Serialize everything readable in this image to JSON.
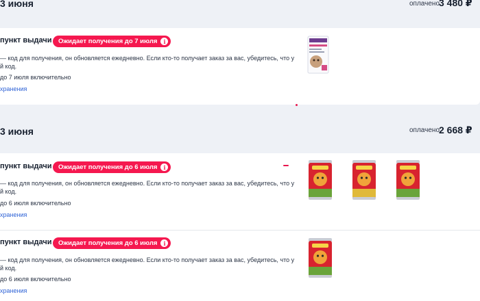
{
  "order1": {
    "date": "3 июня",
    "paid_label": "оплачено",
    "paid_amount": "3 480 ₽",
    "shipments": [
      {
        "pickup_title": "пункт выдачи",
        "badge": "Ожидает получения до 7 июля",
        "code_desc": "— код для получения, он обновляется ежедневно. Если кто-то получает заказ за вас, убедитесь, что у",
        "code_desc_cont": "й код.",
        "storage_line": "до 7 июля включительно",
        "storage_link": "хранения"
      }
    ]
  },
  "order2": {
    "date": "3 июня",
    "paid_label": "оплачено",
    "paid_amount": "2 668 ₽",
    "shipments": [
      {
        "pickup_title": "пункт выдачи",
        "badge": "Ожидает получения до 6 июля",
        "code_desc": "— код для получения, он обновляется ежедневно. Если кто-то получает заказ за вас, убедитесь, что у",
        "code_desc_cont": "й код.",
        "storage_line": "до 6 июля включительно",
        "storage_link": "хранения"
      },
      {
        "pickup_title": "пункт выдачи",
        "badge": "Ожидает получения до 6 июля",
        "code_desc": "— код для получения, он обновляется ежедневно. Если кто-то получает заказ за вас, убедитесь, что у",
        "code_desc_cont": "й код.",
        "storage_line": "до 6 июля включительно",
        "storage_link": "хранения"
      }
    ]
  },
  "icons": {
    "info": "info-icon",
    "product_box": "cat-food-box-image",
    "product_can": "cat-food-can-image"
  },
  "colors": {
    "accent": "#f5184f",
    "link": "#2f63d6",
    "page_bg": "#eef1f6"
  }
}
